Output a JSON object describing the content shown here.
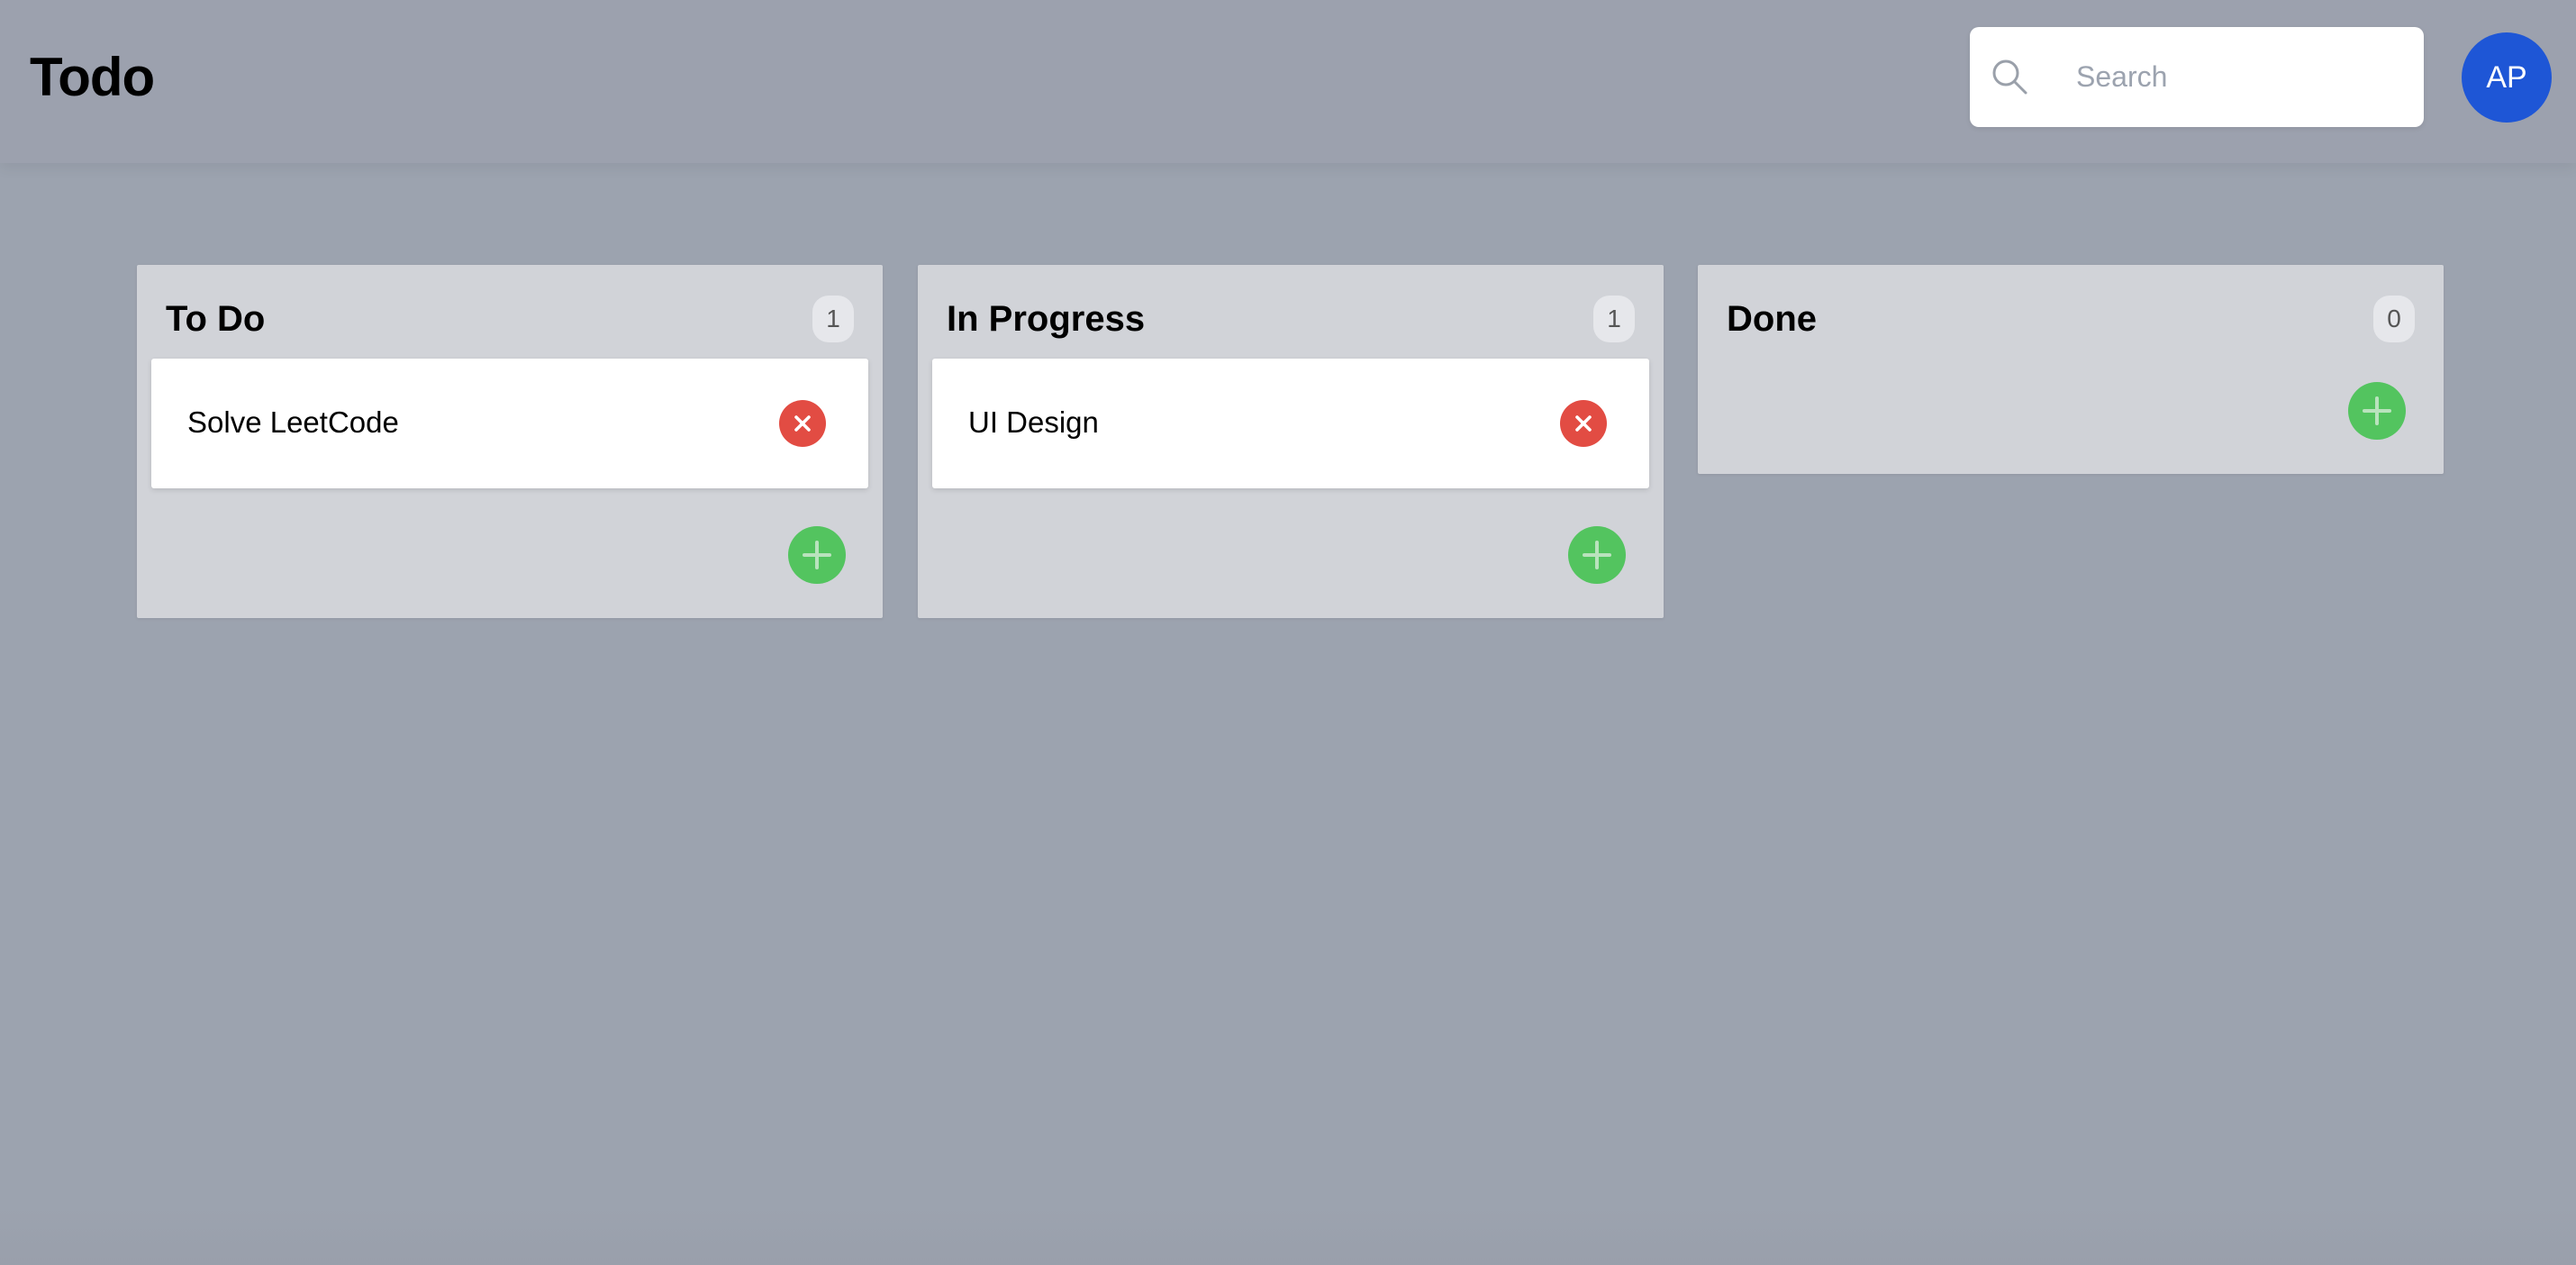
{
  "header": {
    "title": "Todo",
    "search_placeholder": "Search",
    "search_value": "",
    "avatar_initials": "AP",
    "avatar_color": "#1e56d6"
  },
  "columns": [
    {
      "title": "To Do",
      "count": "1",
      "cards": [
        {
          "text": "Solve LeetCode",
          "delete_icon": "close-icon"
        }
      ],
      "add_icon": "plus-icon"
    },
    {
      "title": "In Progress",
      "count": "1",
      "cards": [
        {
          "text": "UI Design",
          "delete_icon": "close-icon"
        }
      ],
      "add_icon": "plus-icon"
    },
    {
      "title": "Done",
      "count": "0",
      "cards": [],
      "add_icon": "plus-icon"
    }
  ],
  "colors": {
    "background": "#9ca3af",
    "column_bg": "#d1d3d8",
    "delete": "#e24c43",
    "add": "#53c45f",
    "accent": "#1e56d6"
  }
}
